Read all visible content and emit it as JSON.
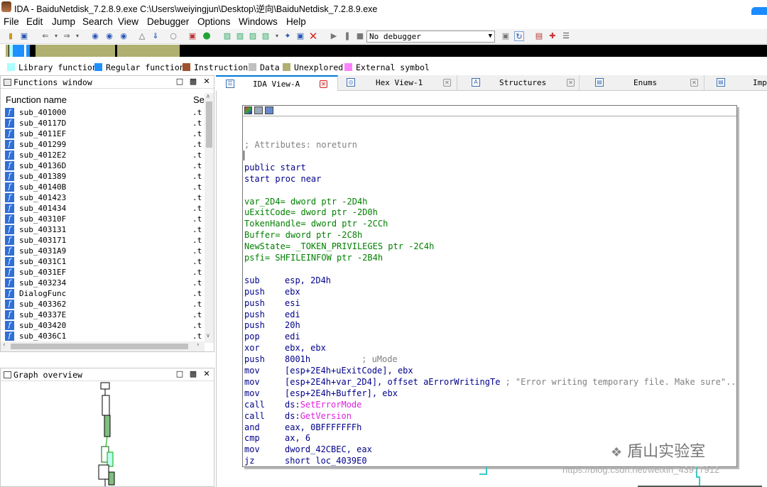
{
  "window": {
    "title": "IDA - BaiduNetdisk_7.2.8.9.exe C:\\Users\\weiyingjun\\Desktop\\逆向\\BaiduNetdisk_7.2.8.9.exe"
  },
  "menu": [
    "File",
    "Edit",
    "Jump",
    "Search",
    "View",
    "Debugger",
    "Options",
    "Windows",
    "Help"
  ],
  "toolbar": {
    "debugger_select": "No debugger"
  },
  "legend": [
    {
      "label": "Library function",
      "color": "#aaffff"
    },
    {
      "label": "Regular function",
      "color": "#1e90ff"
    },
    {
      "label": "Instruction",
      "color": "#a0522d"
    },
    {
      "label": "Data",
      "color": "#c0c0c0"
    },
    {
      "label": "Unexplored",
      "color": "#b0b070"
    },
    {
      "label": "External symbol",
      "color": "#ff80ff"
    }
  ],
  "functions_window": {
    "title": "Functions window",
    "col_name": "Function name",
    "col_segment": "Se",
    "rows": [
      {
        "name": "sub_401000",
        "seg": ".t"
      },
      {
        "name": "sub_40117D",
        "seg": ".t"
      },
      {
        "name": "sub_4011EF",
        "seg": ".t"
      },
      {
        "name": "sub_401299",
        "seg": ".t"
      },
      {
        "name": "sub_4012E2",
        "seg": ".t"
      },
      {
        "name": "sub_40136D",
        "seg": ".t"
      },
      {
        "name": "sub_401389",
        "seg": ".t"
      },
      {
        "name": "sub_40140B",
        "seg": ".t"
      },
      {
        "name": "sub_401423",
        "seg": ".t"
      },
      {
        "name": "sub_401434",
        "seg": ".t"
      },
      {
        "name": "sub_40310F",
        "seg": ".t"
      },
      {
        "name": "sub_403131",
        "seg": ".t"
      },
      {
        "name": "sub_403171",
        "seg": ".t"
      },
      {
        "name": "sub_4031A9",
        "seg": ".t"
      },
      {
        "name": "sub_4031C1",
        "seg": ".t"
      },
      {
        "name": "sub_4031EF",
        "seg": ".t"
      },
      {
        "name": "sub_403234",
        "seg": ".t"
      },
      {
        "name": "DialogFunc",
        "seg": ".t"
      },
      {
        "name": "sub_403362",
        "seg": ".t"
      },
      {
        "name": "sub_40337E",
        "seg": ".t"
      },
      {
        "name": "sub_403420",
        "seg": ".t"
      },
      {
        "name": "sub_4036C1",
        "seg": ".t"
      }
    ]
  },
  "graph_overview": {
    "title": "Graph overview"
  },
  "tabs": [
    {
      "label": "IDA View-A",
      "active": true
    },
    {
      "label": "Hex View-1",
      "active": false
    },
    {
      "label": "Structures",
      "active": false
    },
    {
      "label": "Enums",
      "active": false
    },
    {
      "label": "Imp",
      "active": false
    }
  ],
  "code": {
    "comment_attr": "; Attributes: noreturn",
    "public_line": "public start",
    "proc_line": "start proc near",
    "vars": [
      "var_2D4= dword ptr -2D4h",
      "uExitCode= dword ptr -2D0h",
      "TokenHandle= dword ptr -2CCh",
      "Buffer= dword ptr -2C8h",
      "NewState= _TOKEN_PRIVILEGES ptr -2C4h",
      "psfi= SHFILEINFOW ptr -2B4h"
    ],
    "instructions": [
      {
        "mn": "sub",
        "ops": "esp, 2D4h"
      },
      {
        "mn": "push",
        "ops": "ebx"
      },
      {
        "mn": "push",
        "ops": "esi"
      },
      {
        "mn": "push",
        "ops": "edi"
      },
      {
        "mn": "push",
        "ops": "20h"
      },
      {
        "mn": "pop",
        "ops": "edi"
      },
      {
        "mn": "xor",
        "ops": "ebx, ebx"
      },
      {
        "mn": "push",
        "ops": "8001h",
        "comment": "; uMode"
      },
      {
        "mn": "mov",
        "ops": "[esp+2E4h+uExitCode], ebx"
      },
      {
        "mn": "mov",
        "ops": "[esp+2E4h+var_2D4], offset aErrorWritingTe",
        "comment": "; \"Error writing temporary file. Make sure\"..."
      },
      {
        "mn": "mov",
        "ops": "[esp+2E4h+Buffer], ebx"
      },
      {
        "mn": "call",
        "ops_prefix": "ds:",
        "ops_import": "SetErrorMode"
      },
      {
        "mn": "call",
        "ops_prefix": "ds:",
        "ops_import": "GetVersion"
      },
      {
        "mn": "and",
        "ops": "eax, 0BFFFFFFFh"
      },
      {
        "mn": "cmp",
        "ops": "ax, 6"
      },
      {
        "mn": "mov",
        "ops": "dword_42CBEC, eax"
      },
      {
        "mn": "jz",
        "ops": "short loc_4039E0"
      }
    ]
  },
  "watermark": {
    "brand": "盾山实验室",
    "url": "https://blog.csdn.net/weixin_43977912"
  }
}
